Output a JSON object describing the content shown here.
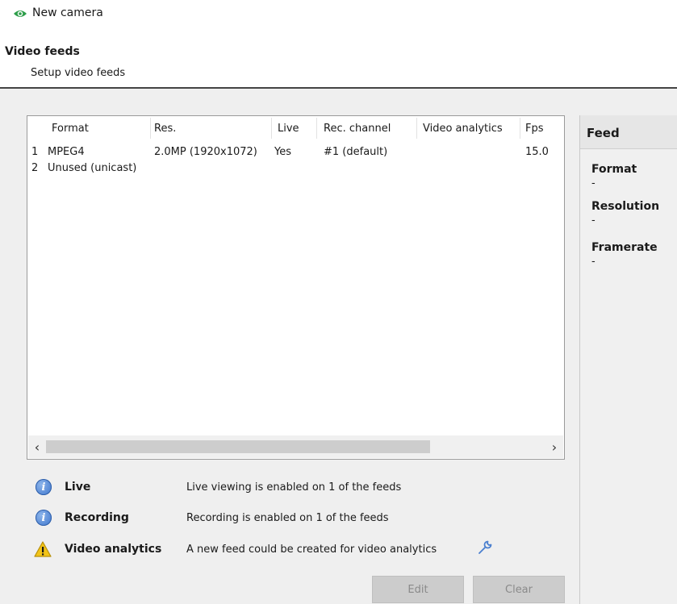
{
  "header": {
    "title": "New camera",
    "section_title": "Video feeds",
    "section_subtitle": "Setup video feeds"
  },
  "table": {
    "columns": [
      "Format",
      "Res.",
      "Live",
      "Rec. channel",
      "Video analytics",
      "Fps"
    ],
    "rows": [
      {
        "num": "1",
        "format": "MPEG4",
        "res": "2.0MP (1920x1072)",
        "live": "Yes",
        "rec_channel": "#1 (default)",
        "video_analytics": "",
        "fps": "15.0"
      },
      {
        "num": "2",
        "format": "Unused (unicast)",
        "res": "",
        "live": "",
        "rec_channel": "",
        "video_analytics": "",
        "fps": ""
      }
    ],
    "scroll_left": "‹",
    "scroll_right": "›"
  },
  "feed_panel": {
    "title": "Feed",
    "format_label": "Format",
    "format_value": "-",
    "resolution_label": "Resolution",
    "resolution_value": "-",
    "framerate_label": "Framerate",
    "framerate_value": "-"
  },
  "info": {
    "live": {
      "label": "Live",
      "text": "Live viewing is enabled on 1 of the feeds",
      "icon": "info-icon"
    },
    "recording": {
      "label": "Recording",
      "text": "Recording is enabled on 1 of the feeds",
      "icon": "info-icon"
    },
    "analytics": {
      "label": "Video analytics",
      "text": "A new feed could be created for video analytics",
      "icon": "warning-icon"
    }
  },
  "buttons": {
    "edit": "Edit",
    "clear": "Clear"
  },
  "colors": {
    "eye_icon": "#2e9e4a",
    "info_icon": "#3b74cc",
    "warning_icon": "#f2c418",
    "panel_bg": "#efefef"
  }
}
